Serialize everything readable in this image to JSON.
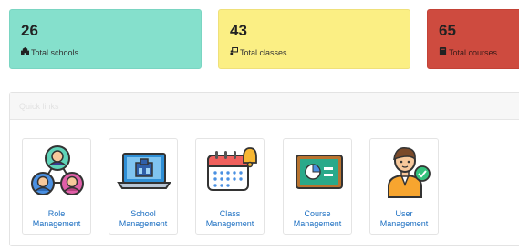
{
  "stats": [
    {
      "value": "26",
      "label": "Total schools",
      "icon": "school-icon",
      "color": "#85e0cc"
    },
    {
      "value": "43",
      "label": "Total classes",
      "icon": "classroom-icon",
      "color": "#fbef84"
    },
    {
      "value": "65",
      "label": "Total courses",
      "icon": "book-icon",
      "color": "#ce4b3f"
    }
  ],
  "quick_links": {
    "title": "Quick links",
    "items": [
      {
        "line1": "Role",
        "line2": "Management",
        "icon": "role-network-icon"
      },
      {
        "line1": "School",
        "line2": "Management",
        "icon": "laptop-school-icon"
      },
      {
        "line1": "Class",
        "line2": "Management",
        "icon": "calendar-bell-icon"
      },
      {
        "line1": "Course",
        "line2": "Management",
        "icon": "chalkboard-icon"
      },
      {
        "line1": "User",
        "line2": "Management",
        "icon": "user-check-icon"
      }
    ]
  }
}
